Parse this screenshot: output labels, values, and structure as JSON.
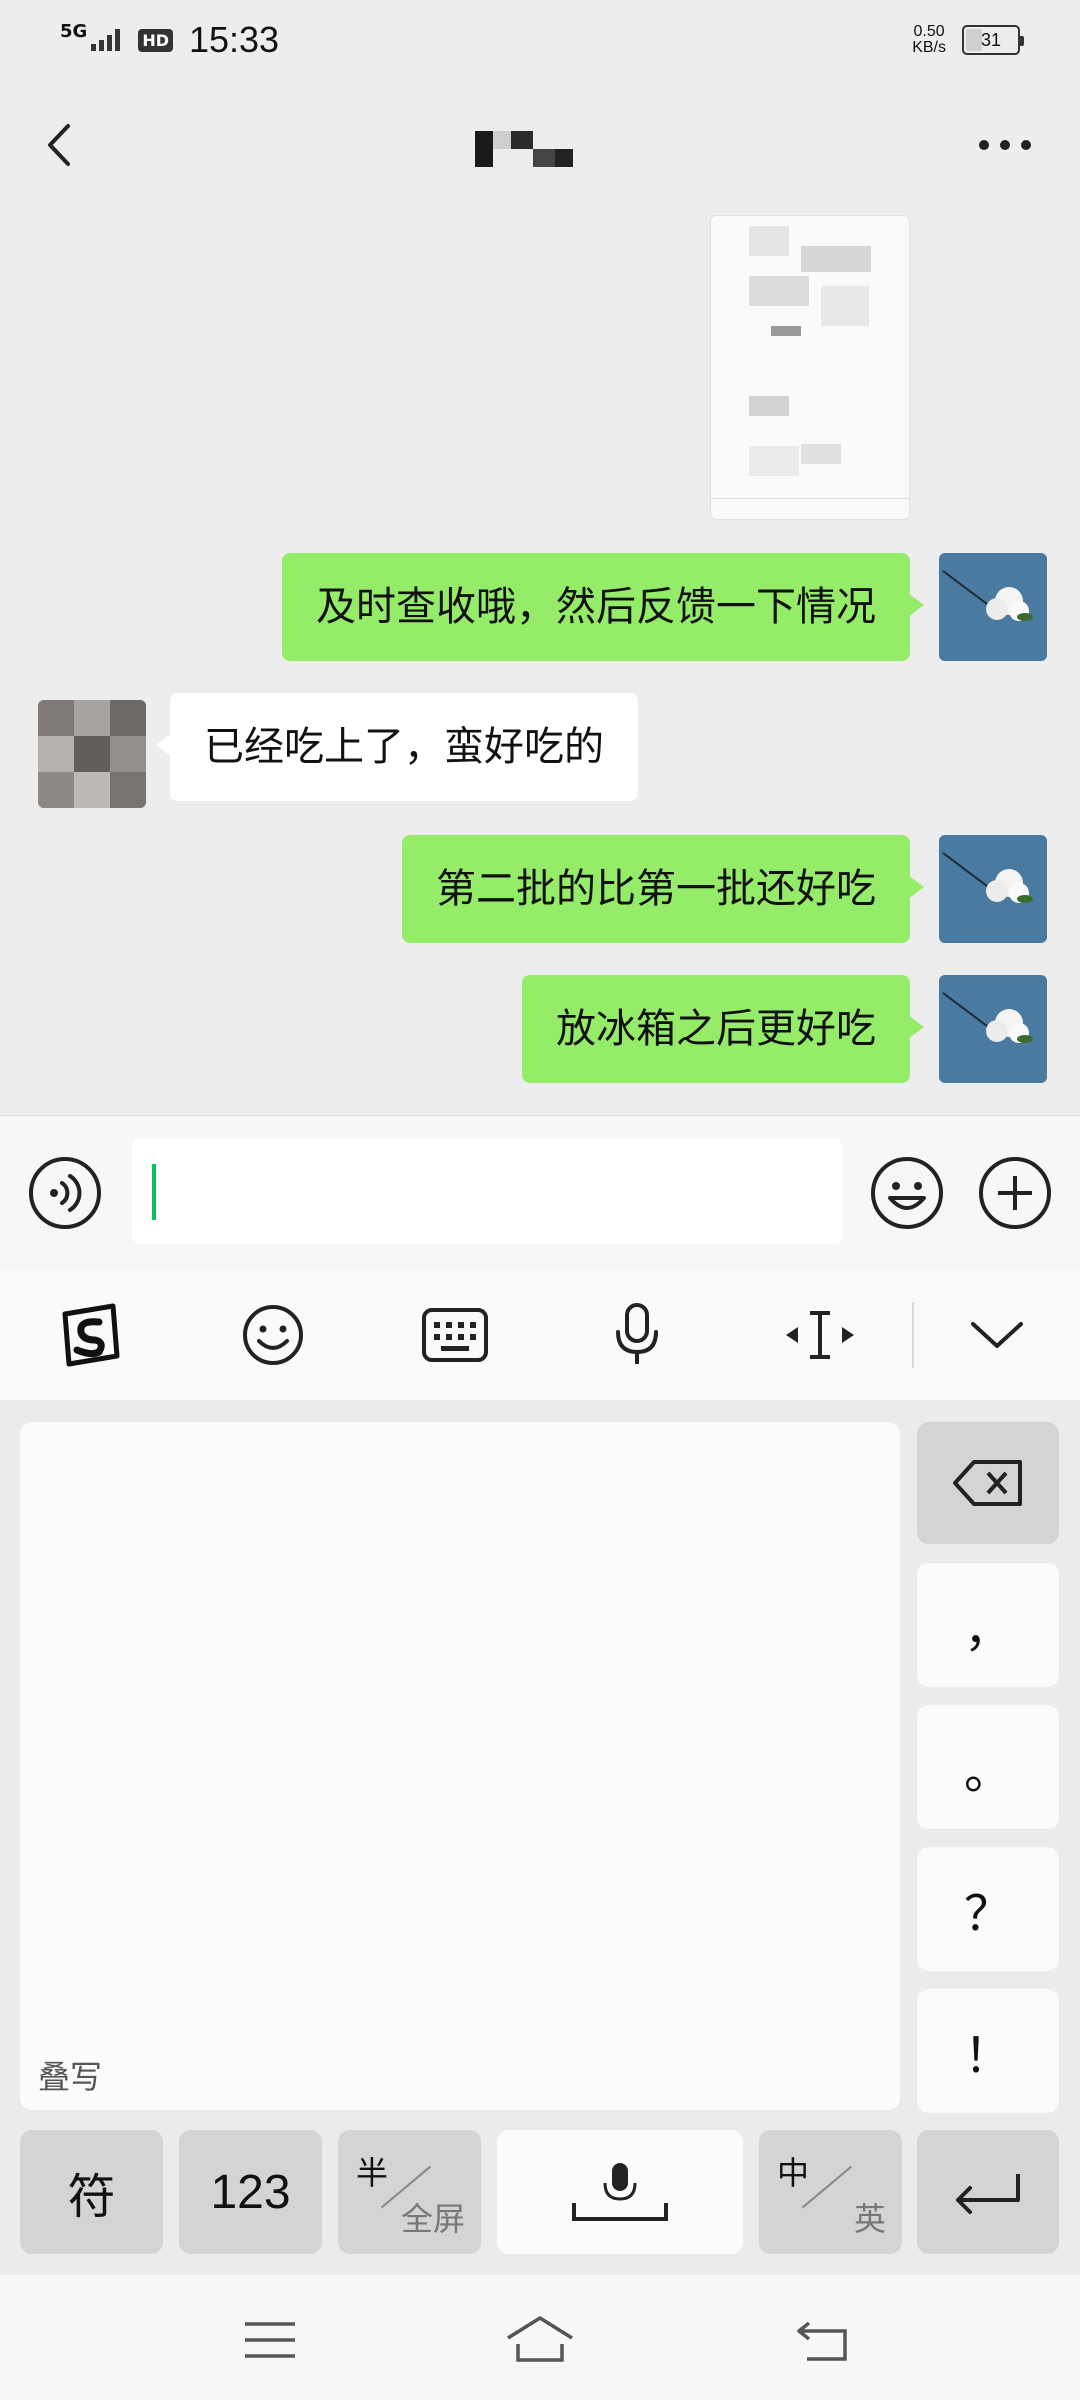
{
  "status_bar": {
    "network": "5G",
    "hd": "HD",
    "time": "15:33",
    "speed_value": "0.50",
    "speed_unit": "KB/s",
    "battery": "31"
  },
  "header": {
    "title": ""
  },
  "messages": [
    {
      "side": "me",
      "text": "及时查收哦，然后反馈一下情况"
    },
    {
      "side": "other",
      "text": "已经吃上了，蛮好吃的"
    },
    {
      "side": "me",
      "text": "第二批的比第一批还好吃"
    },
    {
      "side": "me",
      "text": "放冰箱之后更好吃"
    }
  ],
  "input": {
    "value": ""
  },
  "keyboard": {
    "handwrite_label": "叠写",
    "punct_keys": [
      "，",
      "。",
      "？",
      "！"
    ],
    "bottom_row": {
      "symbol": "符",
      "numbers": "123",
      "half": "半",
      "full": "全屏",
      "lang_zh": "中",
      "lang_en": "英"
    }
  },
  "colors": {
    "bubble_me": "#95ec69",
    "bubble_other": "#ffffff",
    "caret": "#07c160",
    "chat_bg": "#ededed"
  },
  "icons": {
    "back": "chevron-left-icon",
    "more": "more-dots-icon",
    "voice": "voice-icon",
    "emoji": "emoji-icon",
    "plus": "plus-icon",
    "sogou": "sogou-logo-icon",
    "keyboard": "keyboard-icon",
    "mic": "microphone-icon",
    "cursor": "cursor-move-icon",
    "collapse": "chevron-down-icon",
    "backspace": "backspace-icon",
    "enter": "enter-icon",
    "menu": "menu-icon",
    "home": "home-icon",
    "back_nav": "back-icon"
  }
}
